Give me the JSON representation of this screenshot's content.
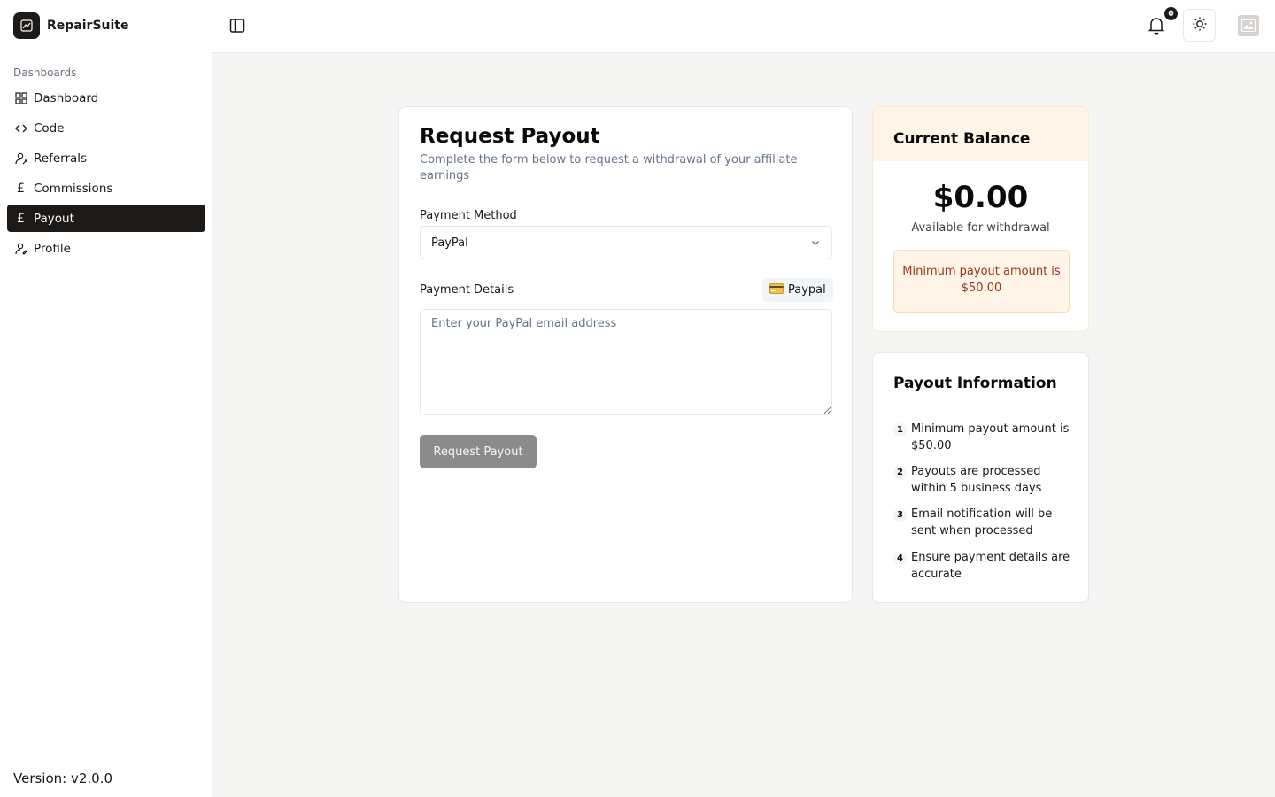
{
  "app": {
    "name": "RepairSuite",
    "version": "Version: v2.0.0"
  },
  "sidebar": {
    "section_label": "Dashboards",
    "items": [
      {
        "label": "Dashboard",
        "icon": "grid-icon"
      },
      {
        "label": "Code",
        "icon": "code-icon"
      },
      {
        "label": "Referrals",
        "icon": "user-referral-icon"
      },
      {
        "label": "Commissions",
        "icon": "pound-icon"
      },
      {
        "label": "Payout",
        "icon": "pound-icon",
        "active": true
      },
      {
        "label": "Profile",
        "icon": "user-icon"
      }
    ]
  },
  "header": {
    "notification_count": "0"
  },
  "form": {
    "title": "Request Payout",
    "subtitle": "Complete the form below to request a withdrawal of your affiliate earnings",
    "payment_method_label": "Payment Method",
    "payment_method_value": "PayPal",
    "payment_details_label": "Payment Details",
    "method_pill": "Paypal",
    "details_placeholder": "Enter your PayPal email address",
    "submit_label": "Request Payout"
  },
  "balance": {
    "title": "Current Balance",
    "amount": "$0.00",
    "available_label": "Available for withdrawal",
    "minimum_note": "Minimum payout amount is $50.00"
  },
  "info": {
    "title": "Payout Information",
    "items": [
      {
        "num": "1",
        "text": "Minimum payout amount is $50.00"
      },
      {
        "num": "2",
        "text": "Payouts are processed within 5 business days"
      },
      {
        "num": "3",
        "text": "Email notification will be sent when processed"
      },
      {
        "num": "4",
        "text": "Ensure payment details are accurate"
      }
    ]
  },
  "colors": {
    "accent": "#1c1917",
    "background": "#f5f5f4",
    "warning": "#9a3412"
  }
}
